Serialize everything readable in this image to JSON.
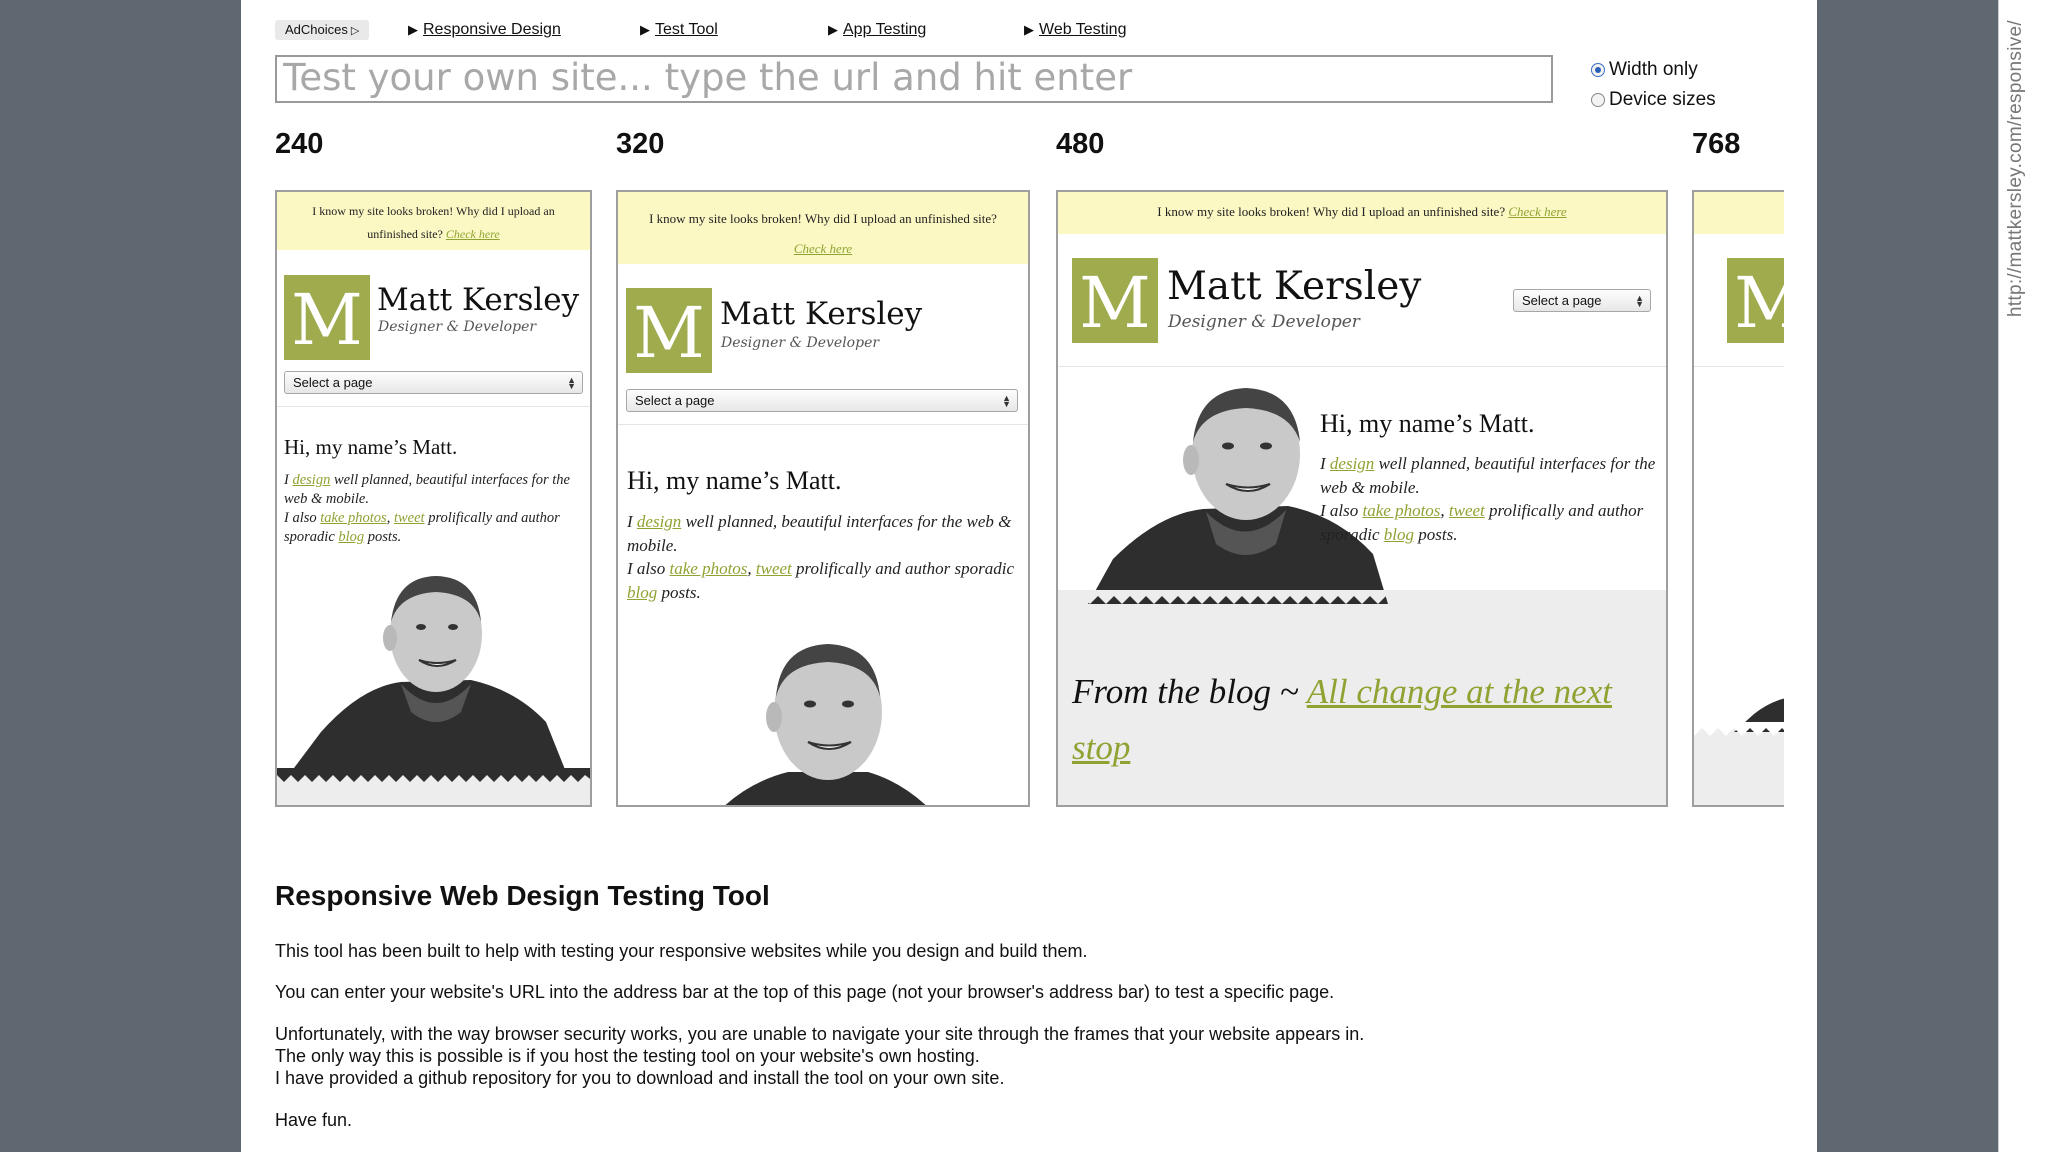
{
  "adchoices": "AdChoices",
  "nav": [
    {
      "label": "Responsive Design"
    },
    {
      "label": "Test Tool"
    },
    {
      "label": "App Testing"
    },
    {
      "label": "Web Testing"
    }
  ],
  "url_field": {
    "placeholder": "Test your own site... type the url and hit enter",
    "value": ""
  },
  "radios": [
    {
      "label": "Width only",
      "checked": true
    },
    {
      "label": "Device sizes",
      "checked": false
    }
  ],
  "widths": [
    "240",
    "320",
    "480",
    "768"
  ],
  "site": {
    "banner_text": "I know my site looks broken! Why did I upload an unfinished site?",
    "banner_link": "Check here",
    "logo_letter": "M",
    "name": "Matt Kersley",
    "tagline": "Designer & Developer",
    "select_label": "Select a page",
    "greeting": "Hi, my name’s Matt.",
    "para": {
      "i": "I",
      "design": "design",
      "l1_rest": "well planned, beautiful interfaces for the web & mobile.",
      "i_also": "I also",
      "photos": "take photos",
      "comma": ",",
      "tweet": "tweet",
      "mid": "prolifically and author sporadic",
      "blog": "blog",
      "end": "posts."
    },
    "blog_prefix": "From the blog ~",
    "blog_link": "All change at the next stop"
  },
  "content": {
    "heading": "Responsive Web Design Testing Tool",
    "p1": "This tool has been built to help with testing your responsive websites while you design and build them.",
    "p2": "You can enter your website's URL into the address bar at the top of this page (not your browser's address bar) to test a specific page.",
    "p3_l1": "Unfortunately, with the way browser security works, you are unable to navigate your site through the frames that your website appears in.",
    "p3_l2": "The only way this is possible is if you host the testing tool on your website's own hosting.",
    "p3_l3": "I have provided a github repository for you to download and install the tool on your own site.",
    "p4": "Have fun."
  },
  "source_url": "http://mattkersley.com/responsive/"
}
